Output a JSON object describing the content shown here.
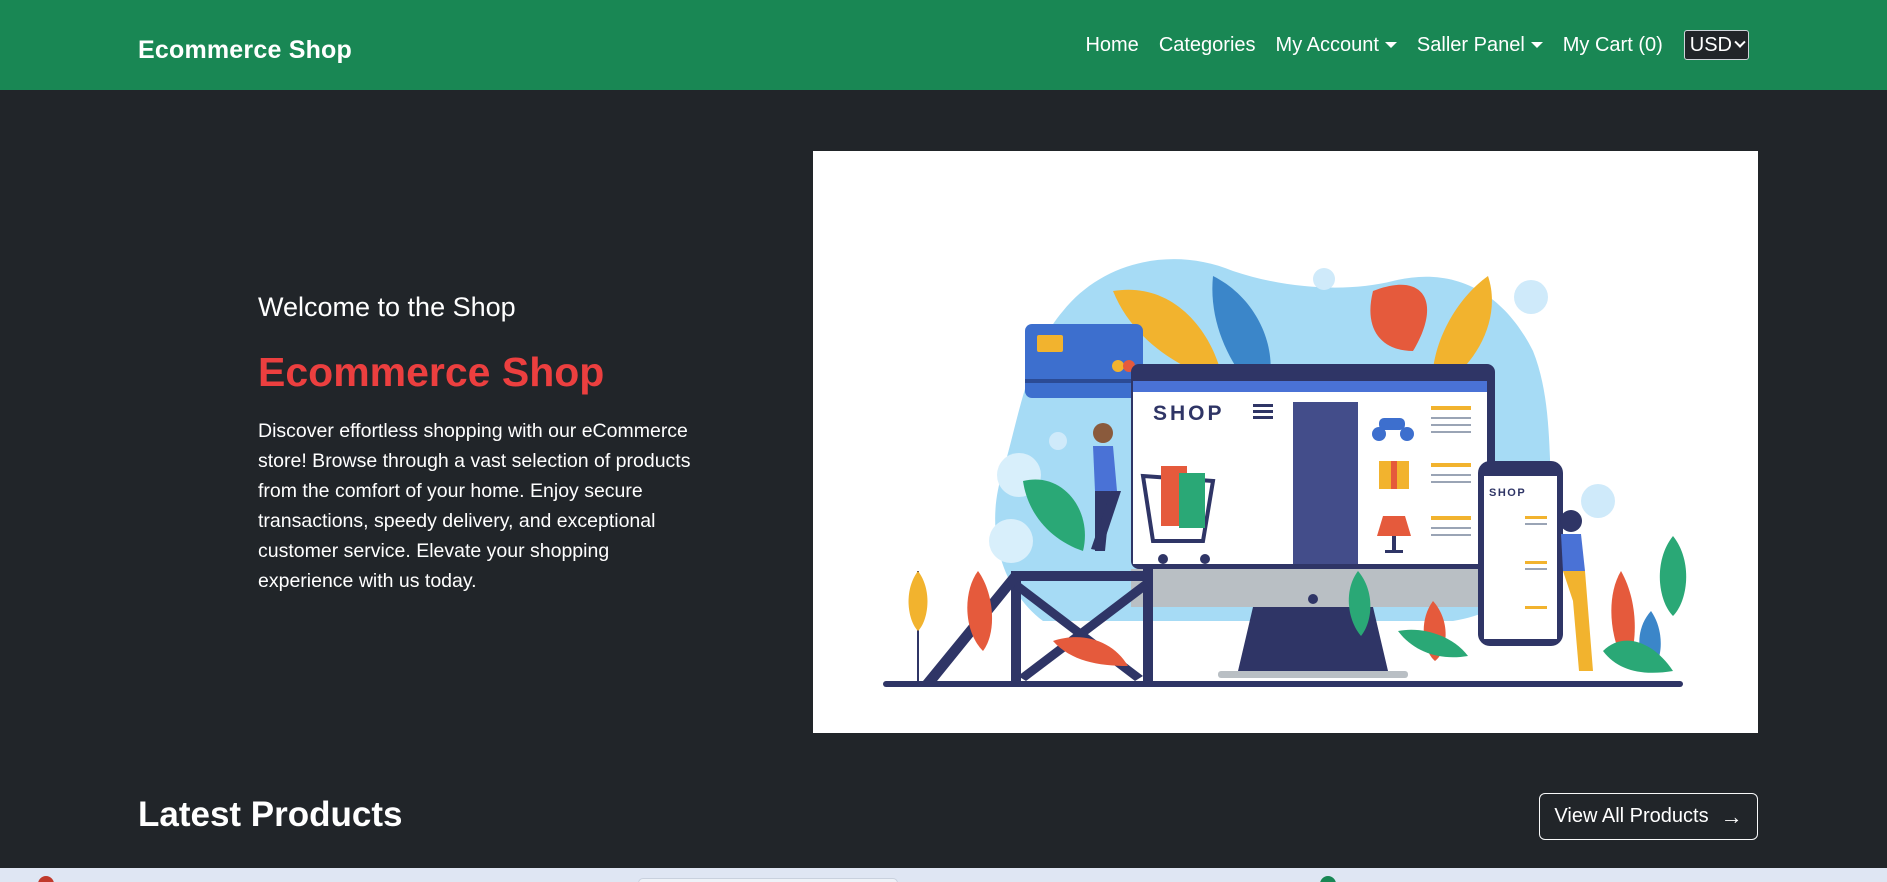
{
  "navbar": {
    "brand": "Ecommerce Shop",
    "links": [
      "Home",
      "Categories",
      "My Account",
      "Saller Panel",
      "My Cart (0)"
    ],
    "currency": "USD"
  },
  "hero": {
    "subtitle": "Welcome to the Shop",
    "title": "Ecommerce Shop",
    "description": "Discover effortless shopping with our eCommerce store! Browse through a vast selection of products from the comfort of your home. Enjoy secure transactions, speedy delivery, and exceptional customer service. Elevate your shopping experience with us today.",
    "image_shop_label": "SHOP",
    "image_phone_label": "SHOP"
  },
  "latest": {
    "title": "Latest Products",
    "view_all_label": "View All Products"
  },
  "colors": {
    "navbar": "#198754",
    "background": "#212529",
    "accent_red": "#ec3f3f"
  }
}
